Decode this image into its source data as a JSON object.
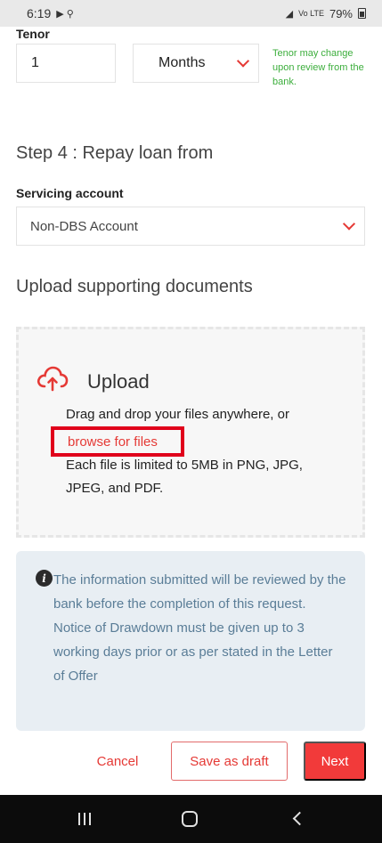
{
  "status_bar": {
    "time": "6:19",
    "notif_icons": "▶ ⚲",
    "signal_text": "Vo LTE",
    "battery": "79%"
  },
  "tenor": {
    "label": "Tenor",
    "value": "1",
    "unit": "Months",
    "hint": "Tenor may change upon review from the bank."
  },
  "step4": {
    "title": "Step 4 : Repay loan from",
    "account_label": "Servicing account",
    "account_value": "Non-DBS Account"
  },
  "upload_section": {
    "title": "Upload supporting documents",
    "upload_label": "Upload",
    "drag_text": "Drag and drop your files anywhere, or",
    "browse_link": "browse for files",
    "limit_line1": "Each file is limited to 5MB in PNG, JPG,",
    "limit_line2": "JPEG, and PDF."
  },
  "info": {
    "text": "The information submitted will be reviewed by the bank before the completion of this request. Notice of Drawdown must be given up to 3 working days prior or as per stated in the Letter of Offer"
  },
  "actions": {
    "cancel": "Cancel",
    "save_draft": "Save as draft",
    "next": "Next"
  },
  "colors": {
    "accent": "#e53935",
    "hint_green": "#3cae3c",
    "info_bg": "#e8eef3",
    "info_text": "#5a7d97",
    "highlight_box": "#e0001b"
  },
  "icons": {
    "upload": "cloud-upload-icon",
    "info": "info-icon",
    "chevron": "chevron-down-icon"
  }
}
